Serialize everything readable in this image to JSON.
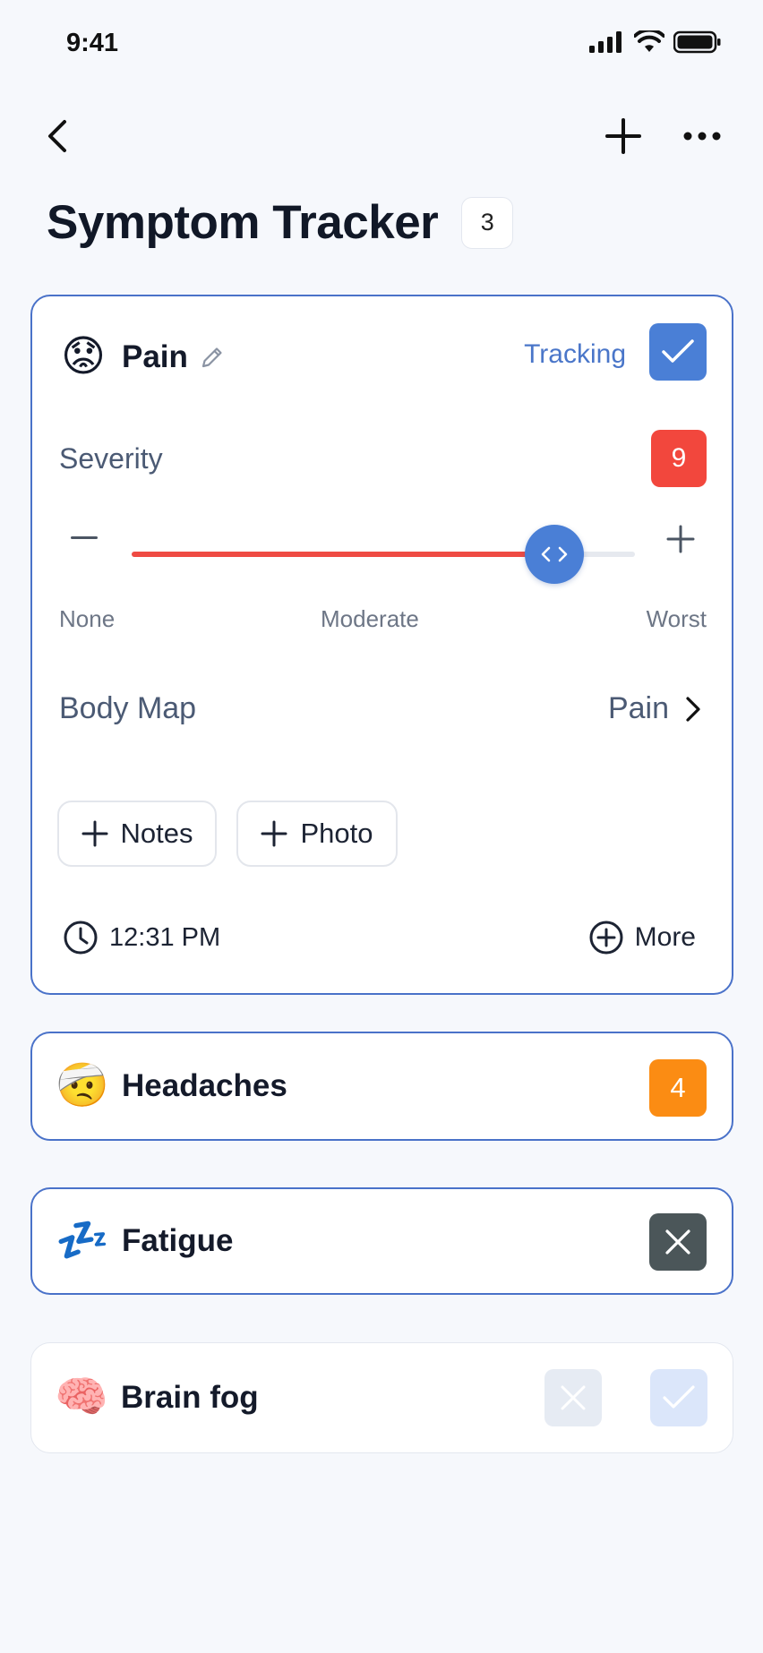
{
  "status": {
    "time": "9:41"
  },
  "nav": {
    "back": "chevron-left-icon",
    "add": "plus-icon",
    "more": "ellipsis-icon"
  },
  "header": {
    "title": "Symptom Tracker",
    "count": "3"
  },
  "main_card": {
    "emoji": "😟",
    "name": "Pain",
    "tracking_label": "Tracking",
    "tracking_checked": true,
    "severity_label": "Severity",
    "severity_value": "9",
    "slider_fraction": 0.84,
    "scale": {
      "min": "None",
      "mid": "Moderate",
      "max": "Worst"
    },
    "body_map_label": "Body Map",
    "body_map_value": "Pain",
    "chip_notes": "Notes",
    "chip_photo": "Photo",
    "time": "12:31 PM",
    "more_label": "More"
  },
  "symptoms": [
    {
      "emoji": "🤕",
      "name": "Headaches",
      "value": "4"
    },
    {
      "emoji": "💤",
      "name": "Fatigue"
    },
    {
      "emoji": "🧠",
      "name": "Brain fog"
    }
  ],
  "colors": {
    "accent": "#4a7fd6",
    "severe": "#f2473d",
    "moderate": "#fb8c13",
    "border": "#4a72c9"
  }
}
